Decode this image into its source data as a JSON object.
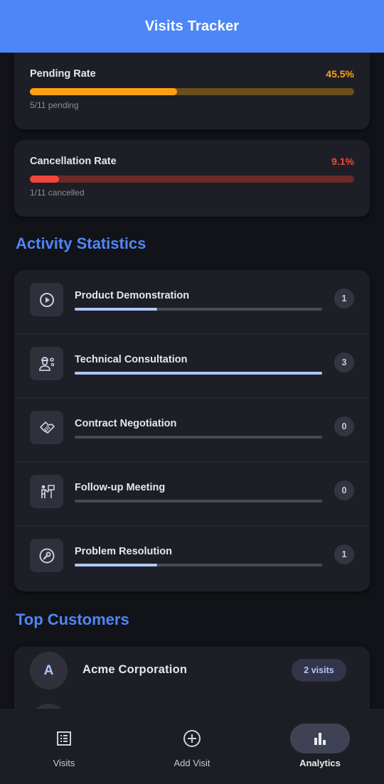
{
  "header": {
    "title": "Visits Tracker"
  },
  "rates": [
    {
      "label": "Pending Rate",
      "percent_text": "45.5%",
      "fraction": 0.455,
      "subtitle": "5/11 pending",
      "color": "#ffa014",
      "track_color": "#6a4f1c"
    },
    {
      "label": "Cancellation Rate",
      "percent_text": "9.1%",
      "fraction": 0.091,
      "subtitle": "1/11 cancelled",
      "color": "#f4453b",
      "track_color": "#6a2a2a"
    }
  ],
  "activity": {
    "title": "Activity Statistics",
    "max_count": 3,
    "items": [
      {
        "label": "Product Demonstration",
        "count": "1",
        "icon": "play-circle-icon"
      },
      {
        "label": "Technical Consultation",
        "count": "3",
        "icon": "engineer-icon"
      },
      {
        "label": "Contract Negotiation",
        "count": "0",
        "icon": "handshake-icon"
      },
      {
        "label": "Follow-up Meeting",
        "count": "0",
        "icon": "presenter-icon"
      },
      {
        "label": "Problem Resolution",
        "count": "1",
        "icon": "wrench-icon"
      }
    ]
  },
  "customers": {
    "title": "Top Customers",
    "items": [
      {
        "initial": "A",
        "name": "Acme Corporation",
        "visits": "2 visits"
      }
    ]
  },
  "nav": {
    "items": [
      {
        "label": "Visits",
        "icon": "list-icon",
        "active": false
      },
      {
        "label": "Add Visit",
        "icon": "add-circle-icon",
        "active": false
      },
      {
        "label": "Analytics",
        "icon": "bar-chart-icon",
        "active": true
      }
    ]
  }
}
